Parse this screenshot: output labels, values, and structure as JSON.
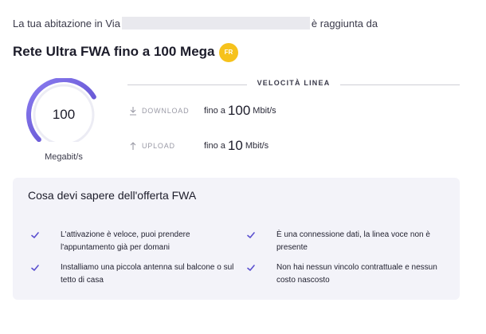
{
  "address": {
    "prefix": "La tua abitazione in Via",
    "suffix": "è raggiunta da"
  },
  "offer": {
    "title": "Rete Ultra FWA fino a 100 Mega",
    "badge_text": "FR",
    "badge_color": "#f6c21c"
  },
  "gauge": {
    "value": "100",
    "unit": "Megabit/s",
    "fill_fraction": 0.72,
    "accent_color": "#6b5bd6"
  },
  "speed": {
    "header": "VELOCITÀ LINEA",
    "download": {
      "icon": "download-arrow-icon",
      "label": "DOWNLOAD",
      "prefix": "fino a",
      "value": "100",
      "unit": "Mbit/s"
    },
    "upload": {
      "icon": "upload-arrow-icon",
      "label": "UPLOAD",
      "prefix": "fino a",
      "value": "10",
      "unit": "Mbit/s"
    }
  },
  "info": {
    "title": "Cosa devi sapere dell'offerta FWA",
    "check_icon": "check-icon",
    "check_color": "#5a4fcf",
    "items": [
      {
        "text": "L'attivazione è veloce, puoi prendere l'appuntamento già per domani"
      },
      {
        "text": "È una connessione dati, la linea voce non è presente"
      },
      {
        "text": "Installiamo una piccola antenna sul balcone o sul tetto di casa"
      },
      {
        "text": "Non hai nessun vincolo contrattuale e nessun costo nascosto"
      }
    ]
  }
}
